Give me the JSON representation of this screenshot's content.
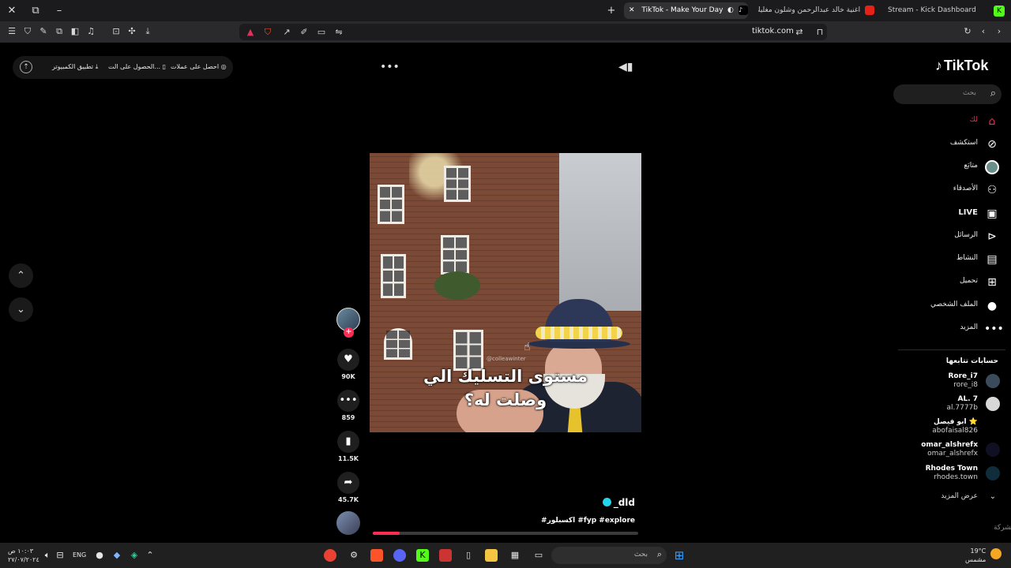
{
  "browser": {
    "tabs": [
      {
        "title": "TikTok - Make Your Day",
        "active": true
      },
      {
        "title": "اغنية خالد عبدالرحمن وشلون مغليك - ...",
        "active": false
      },
      {
        "title": "Stream - Kick Dashboard",
        "active": false
      }
    ],
    "url": "tiktok.com",
    "accent": "#fe2c55"
  },
  "topbar": {
    "get_coins": "احصل على عملات",
    "get_app": "الحصول على الت...",
    "desktop_app": "تطبيق الكمبيوتر"
  },
  "sidebar": {
    "logo": "TikTok",
    "search_placeholder": "بحث",
    "nav": [
      {
        "label": "لك",
        "icon": "home-icon"
      },
      {
        "label": "استكشف",
        "icon": "compass-icon"
      },
      {
        "label": "متابَع",
        "icon": "avatar-icon"
      },
      {
        "label": "الأصدقاء",
        "icon": "friends-icon"
      },
      {
        "label": "LIVE",
        "icon": "live-icon"
      },
      {
        "label": "الرسائل",
        "icon": "send-icon"
      },
      {
        "label": "النشاط",
        "icon": "activity-icon"
      },
      {
        "label": "تحميل",
        "icon": "upload-icon"
      },
      {
        "label": "الملف الشخصي",
        "icon": "profile-icon"
      },
      {
        "label": "المزيد",
        "icon": "more-icon"
      }
    ],
    "following_title": "حسابات تتابعها",
    "following": [
      {
        "name": "Rore_i7",
        "handle": "rore_i8",
        "color": "#3c4b5c"
      },
      {
        "name": "AL. 7",
        "handle": "al.7777b",
        "color": "#d8d8d8"
      },
      {
        "name": "ابو فيصل ⭐",
        "handle": "abofaisal826",
        "color": "#000000"
      },
      {
        "name": "omar_alshrefx",
        "handle": "omar_alshrefx",
        "color": "#101024"
      },
      {
        "name": "Rhodes Town",
        "handle": "rhodes.town",
        "color": "#0f2d3a"
      }
    ],
    "see_more": "عرض المزيد",
    "company": "الشركة"
  },
  "video": {
    "caption_line1": "مستوى التسليك الي",
    "caption_line2": "وصلت له؟",
    "watermark": "@colleawinter",
    "author": "_dld",
    "hashtags": "#اكسبلور #fyp #explore",
    "progress": 0.1
  },
  "actions": {
    "likes": "90K",
    "comments": "859",
    "saves": "11.5K",
    "shares": "45.7K"
  },
  "taskbar": {
    "search_placeholder": "بحث",
    "lang": "ENG",
    "time": "١٠:٠٣ ص",
    "date": "٢٧/٠٧/٢٠٢٤",
    "temp": "19°C",
    "weather": "مشمس"
  }
}
